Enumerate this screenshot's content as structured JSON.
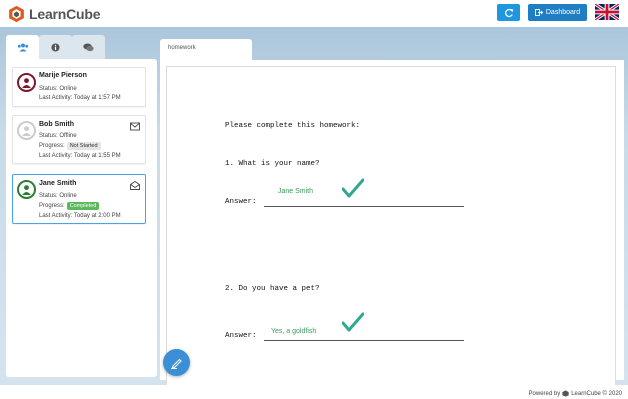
{
  "header": {
    "logo_text": "LearnCube",
    "dashboard_label": "Dashboard",
    "refresh_icon": "refresh-icon",
    "language_flag": "uk-flag"
  },
  "sidebar": {
    "tabs": [
      {
        "icon": "users-icon",
        "active": true
      },
      {
        "icon": "info-icon",
        "active": false
      },
      {
        "icon": "chat-icon",
        "active": false
      }
    ],
    "students": [
      {
        "name": "Marije Pierson",
        "status": "Status: Online",
        "progress_label": "",
        "progress_badge": "",
        "activity": "Last Activity: Today at 1:57 PM",
        "avatar_color": "#7a1a2e"
      },
      {
        "name": "Bob Smith",
        "status": "Status: Offline",
        "progress_label": "Progress:",
        "progress_badge": "Not Started",
        "activity": "Last Activity: Today at 1:55 PM",
        "avatar_color": "#cccccc"
      },
      {
        "name": "Jane Smith",
        "status": "Status: Online",
        "progress_label": "Progress:",
        "progress_badge": "Completed",
        "activity": "Last Activity: Today at 2:00 PM",
        "avatar_color": "#2e7d32"
      }
    ]
  },
  "document": {
    "tab_label": "homework",
    "instruction": "Please complete this homework:",
    "q1": "1. What is your name?",
    "q1_answer_label": "Answer:",
    "q1_answer": "Jane Smith",
    "q2": "2. Do you have a pet?",
    "q2_answer_label": "Answer:",
    "q2_answer": "Yes, a goldfish"
  },
  "footer": {
    "powered_by": "Powered by",
    "brand": "LearnCube © 2020"
  },
  "colors": {
    "accent_blue": "#1f7ec4",
    "completed_green": "#5cb85c",
    "check_teal": "#2fa88e"
  }
}
